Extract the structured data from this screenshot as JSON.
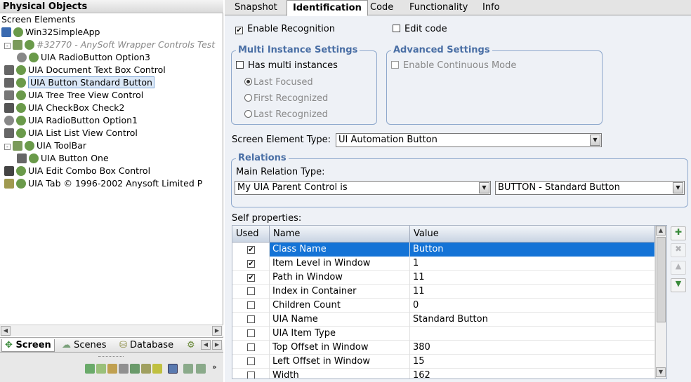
{
  "left_panel": {
    "title": "Physical Objects",
    "tree": [
      {
        "label": "Screen Elements",
        "icon": "none",
        "x": 2,
        "depth": 0
      },
      {
        "label": "Win32SimpleApp",
        "icon": "app-icon",
        "x": 2,
        "depth": 0
      },
      {
        "label": "#32770 - AnySoft Wrapper Controls Test",
        "icon": "window-icon",
        "x": 6,
        "depth": 1,
        "grayed": true,
        "box": "-"
      },
      {
        "label": "UIA RadioButton Option3",
        "icon": "radio-icon",
        "x": 24,
        "depth": 2
      },
      {
        "label": "UIA Document Text Box Control",
        "icon": "textbox-icon",
        "x": 6,
        "depth": 1
      },
      {
        "label": "UIA Button Standard Button",
        "icon": "ok-button-icon",
        "x": 6,
        "depth": 1,
        "selected": true
      },
      {
        "label": "UIA Tree Tree View Control",
        "icon": "tree-icon",
        "x": 6,
        "depth": 1
      },
      {
        "label": "UIA CheckBox Check2",
        "icon": "checkbox-icon",
        "x": 6,
        "depth": 1
      },
      {
        "label": "UIA RadioButton Option1",
        "icon": "radio-icon",
        "x": 6,
        "depth": 1
      },
      {
        "label": "UIA List List View Control",
        "icon": "list-icon",
        "x": 6,
        "depth": 1
      },
      {
        "label": "UIA ToolBar",
        "icon": "toolbar-icon",
        "x": 6,
        "depth": 1,
        "box": "-"
      },
      {
        "label": "UIA Button One",
        "icon": "ok-button-icon",
        "x": 24,
        "depth": 2
      },
      {
        "label": "UIA Edit Combo Box Control",
        "icon": "edit-icon",
        "x": 6,
        "depth": 1
      },
      {
        "label": "UIA Tab © 1996-2002 Anysoft Limited P",
        "icon": "tab-icon",
        "x": 6,
        "depth": 1
      }
    ],
    "bottom_tabs": [
      {
        "label": "Screen",
        "active": true
      },
      {
        "label": "Scenes",
        "active": false
      },
      {
        "label": "Database",
        "active": false
      }
    ]
  },
  "tabs": [
    {
      "label": "Snapshot",
      "active": false
    },
    {
      "label": "Identification",
      "active": true
    },
    {
      "label": "Code",
      "active": false
    },
    {
      "label": "Functionality",
      "active": false
    },
    {
      "label": "Info",
      "active": false
    }
  ],
  "identification": {
    "enable_recognition": {
      "label": "Enable Recognition",
      "checked": true
    },
    "edit_code": {
      "label": "Edit code",
      "checked": false
    },
    "multi_instance": {
      "title": "Multi Instance Settings",
      "has_multi": {
        "label": "Has multi instances",
        "checked": false
      },
      "options": [
        {
          "label": "Last Focused",
          "selected": true
        },
        {
          "label": "First Recognized",
          "selected": false
        },
        {
          "label": "Last Recognized",
          "selected": false
        }
      ]
    },
    "advanced": {
      "title": "Advanced Settings",
      "continuous": {
        "label": "Enable Continuous Mode",
        "checked": false
      }
    },
    "element_type": {
      "label": "Screen Element Type:",
      "value": "UI Automation Button"
    },
    "relations": {
      "title": "Relations",
      "main_label": "Main Relation Type:",
      "relation_value": "My UIA Parent Control is",
      "target_value": "BUTTON - Standard Button"
    },
    "self_properties": {
      "label": "Self properties:",
      "columns": [
        "Used",
        "Name",
        "Value"
      ],
      "rows": [
        {
          "used": true,
          "name": "Class Name",
          "value": "Button",
          "selected": true
        },
        {
          "used": true,
          "name": "Item Level in Window",
          "value": "1"
        },
        {
          "used": true,
          "name": "Path in Window",
          "value": "11"
        },
        {
          "used": false,
          "name": "Index in Container",
          "value": "11"
        },
        {
          "used": false,
          "name": "Children Count",
          "value": "0"
        },
        {
          "used": false,
          "name": "UIA Name",
          "value": "Standard Button"
        },
        {
          "used": false,
          "name": "UIA Item Type",
          "value": ""
        },
        {
          "used": false,
          "name": "Top Offset in Window",
          "value": "380"
        },
        {
          "used": false,
          "name": "Left Offset in Window",
          "value": "15"
        },
        {
          "used": false,
          "name": "Width",
          "value": "162"
        }
      ]
    }
  },
  "colors": {
    "accent": "#1473d6",
    "group_title": "#4a6fa5"
  }
}
